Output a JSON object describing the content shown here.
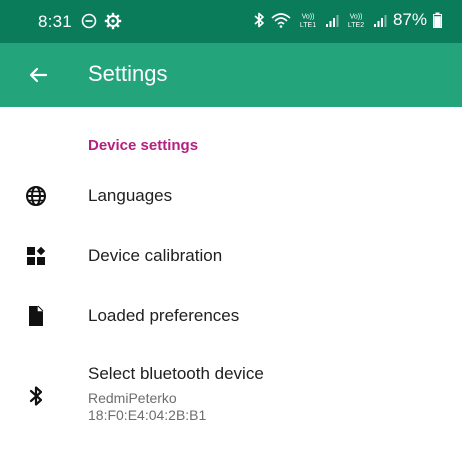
{
  "status_bar": {
    "time": "8:31",
    "battery": "87%",
    "left_icons": [
      "do-not-disturb-icon",
      "settings-gear-icon"
    ],
    "right_icons": [
      "bluetooth-icon",
      "wifi-icon",
      "volte-lte1-icon",
      "signal-1-icon",
      "volte-lte2-icon",
      "signal-2-icon",
      "battery-icon"
    ],
    "volte_label": "Vo))",
    "lte1_label": "LTE1",
    "lte2_label": "LTE2"
  },
  "app_bar": {
    "title": "Settings",
    "back_icon": "arrow-back-icon",
    "background": "#23a47a",
    "status_background": "#0b7c5a"
  },
  "settings": {
    "section_title": "Device settings",
    "section_color": "#b5207f",
    "items": [
      {
        "icon": "globe-icon",
        "title": "Languages"
      },
      {
        "icon": "widgets-icon",
        "title": "Device calibration"
      },
      {
        "icon": "file-icon",
        "title": "Loaded preferences"
      },
      {
        "icon": "bluetooth-icon",
        "title": "Select bluetooth device",
        "summary_line1": "RedmiPeterko",
        "summary_line2": "18:F0:E4:04:2B:B1"
      }
    ]
  }
}
